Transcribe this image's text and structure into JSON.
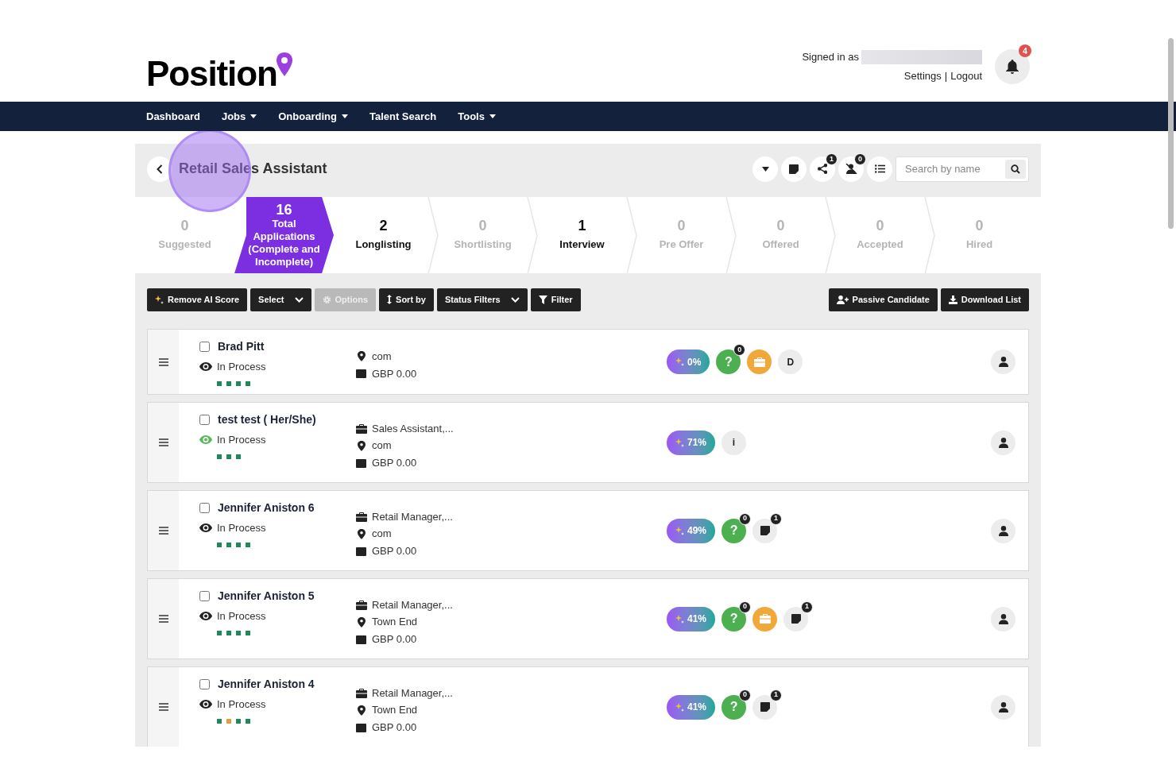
{
  "header": {
    "logo": "Position",
    "signed_in_label": "Signed in as",
    "links": [
      "Settings",
      "Logout"
    ],
    "link_separator": "|",
    "notification_count": "4"
  },
  "nav": [
    {
      "label": "Dashboard",
      "dropdown": false
    },
    {
      "label": "Jobs",
      "dropdown": true
    },
    {
      "label": "Onboarding",
      "dropdown": true
    },
    {
      "label": "Talent Search",
      "dropdown": false
    },
    {
      "label": "Tools",
      "dropdown": true
    }
  ],
  "job": {
    "title": "Retail Sales Assistant",
    "tools": [
      {
        "kind": "caret"
      },
      {
        "kind": "note"
      },
      {
        "kind": "share",
        "count": "1"
      },
      {
        "kind": "user-off",
        "count": "0"
      },
      {
        "kind": "list"
      }
    ],
    "search": {
      "placeholder": "Search by name"
    }
  },
  "stages": [
    {
      "count": "0",
      "label": "Suggested",
      "selected": false,
      "greyed": true
    },
    {
      "count": "16",
      "label": "Total Applications (Complete and Incomplete)",
      "selected": true,
      "greyed": false
    },
    {
      "count": "2",
      "label": "Longlisting",
      "selected": false,
      "greyed": false
    },
    {
      "count": "0",
      "label": "Shortlisting",
      "selected": false,
      "greyed": true
    },
    {
      "count": "1",
      "label": "Interview",
      "selected": false,
      "greyed": false
    },
    {
      "count": "0",
      "label": "Pre Offer",
      "selected": false,
      "greyed": true
    },
    {
      "count": "0",
      "label": "Offered",
      "selected": false,
      "greyed": true
    },
    {
      "count": "0",
      "label": "Accepted",
      "selected": false,
      "greyed": true
    },
    {
      "count": "0",
      "label": "Hired",
      "selected": false,
      "greyed": true
    }
  ],
  "actions_left": [
    {
      "label": "Remove AI Score",
      "kind": "sparkle",
      "dropdown": false,
      "disabled": false
    },
    {
      "label": "Select",
      "kind": "plain",
      "dropdown": true,
      "disabled": false
    },
    {
      "label": "Options",
      "kind": "gear",
      "dropdown": false,
      "disabled": true
    },
    {
      "label": "Sort by",
      "kind": "updown",
      "dropdown": false,
      "disabled": false
    },
    {
      "label": "Status Filters",
      "kind": "plain",
      "dropdown": true,
      "disabled": false
    },
    {
      "label": "Filter",
      "kind": "funnel",
      "dropdown": false,
      "disabled": false
    }
  ],
  "actions_right": [
    {
      "label": "Passive Candidate",
      "kind": "user-plus",
      "dropdown": false,
      "disabled": false
    },
    {
      "label": "Download List",
      "kind": "download",
      "dropdown": false,
      "disabled": false
    }
  ],
  "candidates": [
    {
      "name": "Brad Pitt",
      "checked": false,
      "status": {
        "label": "In Process",
        "color": "#222222"
      },
      "progress": [
        {
          "color": "#1e8a5a"
        },
        {
          "color": "#1e8a5a"
        },
        {
          "color": "#1e8a5a"
        },
        {
          "color": "#1e8a5a"
        }
      ],
      "details": [
        {
          "kind": "location",
          "text": "com"
        },
        {
          "kind": "salary",
          "text": "GBP 0.00"
        }
      ],
      "score": "0%",
      "badges": [
        {
          "kind": "questions",
          "symbol": "?",
          "count": "0"
        },
        {
          "kind": "briefcase"
        },
        {
          "kind": "letter",
          "text": "D"
        }
      ]
    },
    {
      "name": "test test ( Her/She)",
      "checked": false,
      "status": {
        "label": "In Process",
        "color": "#5cb85c"
      },
      "progress": [
        {
          "color": "#1e8a5a"
        },
        {
          "color": "#1e8a5a"
        },
        {
          "color": "#1e8a5a"
        }
      ],
      "details": [
        {
          "kind": "job",
          "text": "Sales Assistant,..."
        },
        {
          "kind": "location",
          "text": "com"
        },
        {
          "kind": "salary",
          "text": "GBP 0.00"
        }
      ],
      "score": "71%",
      "badges": [
        {
          "kind": "letter",
          "text": "i"
        }
      ]
    },
    {
      "name": "Jennifer Aniston 6",
      "checked": false,
      "status": {
        "label": "In Process",
        "color": "#222222"
      },
      "progress": [
        {
          "color": "#1e8a5a"
        },
        {
          "color": "#1e8a5a"
        },
        {
          "color": "#1e8a5a"
        },
        {
          "color": "#1e8a5a"
        }
      ],
      "details": [
        {
          "kind": "job",
          "text": "Retail Manager,..."
        },
        {
          "kind": "location",
          "text": "com"
        },
        {
          "kind": "salary",
          "text": "GBP 0.00"
        }
      ],
      "score": "49%",
      "badges": [
        {
          "kind": "questions",
          "symbol": "?",
          "count": "0"
        },
        {
          "kind": "notes",
          "count": "1"
        }
      ]
    },
    {
      "name": "Jennifer Aniston 5",
      "checked": false,
      "status": {
        "label": "In Process",
        "color": "#222222"
      },
      "progress": [
        {
          "color": "#1e8a5a"
        },
        {
          "color": "#1e8a5a"
        },
        {
          "color": "#1e8a5a"
        },
        {
          "color": "#1e8a5a"
        }
      ],
      "details": [
        {
          "kind": "job",
          "text": "Retail Manager,..."
        },
        {
          "kind": "location",
          "text": "Town End"
        },
        {
          "kind": "salary",
          "text": "GBP 0.00"
        }
      ],
      "score": "41%",
      "badges": [
        {
          "kind": "questions",
          "symbol": "?",
          "count": "0"
        },
        {
          "kind": "briefcase"
        },
        {
          "kind": "notes",
          "count": "1"
        }
      ]
    },
    {
      "name": "Jennifer Aniston 4",
      "checked": false,
      "status": {
        "label": "In Process",
        "color": "#222222"
      },
      "progress": [
        {
          "color": "#1e8a5a"
        },
        {
          "color": "#e0a030"
        },
        {
          "color": "#1e8a5a"
        },
        {
          "color": "#1e8a5a"
        }
      ],
      "details": [
        {
          "kind": "job",
          "text": "Retail Manager,..."
        },
        {
          "kind": "location",
          "text": "Town End"
        },
        {
          "kind": "salary",
          "text": "GBP 0.00"
        }
      ],
      "score": "41%",
      "badges": [
        {
          "kind": "questions",
          "symbol": "?",
          "count": "0"
        },
        {
          "kind": "notes",
          "count": "1"
        }
      ]
    }
  ]
}
